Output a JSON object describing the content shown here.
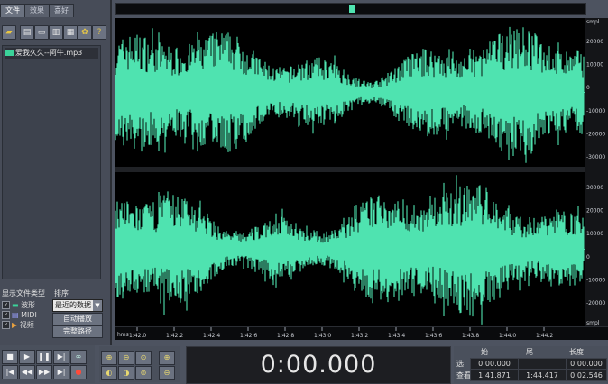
{
  "left_panel": {
    "tabs": [
      "文件",
      "效果",
      "喜好"
    ],
    "file_item": "爱我久久--阿牛.mp3",
    "types_label": "显示文件类型",
    "sort_label": "排序",
    "types": [
      {
        "label": "波形",
        "checked": true
      },
      {
        "label": "MIDI",
        "checked": true
      },
      {
        "label": "视频",
        "checked": true
      }
    ],
    "sort_select": "最近的数据",
    "btn_autoplay": "自动播放",
    "btn_fullpath": "完整路径"
  },
  "wave": {
    "color": "#4fe3b0",
    "ruler_top_unit": "smpl",
    "ruler_bottom_unit": "smpl",
    "ch1_ticks": [
      "20000",
      "10000",
      "0",
      "-10000",
      "-20000",
      "-30000"
    ],
    "ch2_ticks": [
      "30000",
      "20000",
      "10000",
      "0",
      "-10000",
      "-20000"
    ],
    "time_unit": "hms",
    "time_ticks": [
      "1:42.0",
      "1:42.2",
      "1:42.4",
      "1:42.6",
      "1:42.8",
      "1:43.0",
      "1:43.2",
      "1:43.4",
      "1:43.6",
      "1:43.8",
      "1:44.0",
      "1:44.2"
    ]
  },
  "timer": "0:00.000",
  "selection": {
    "headers": [
      "始",
      "尾",
      "长度"
    ],
    "row1_label": "选",
    "row2_label": "查看",
    "row1": [
      "0:00.000",
      "",
      "0:00.000"
    ],
    "row2": [
      "1:41.871",
      "1:44.417",
      "0:02.546"
    ]
  }
}
